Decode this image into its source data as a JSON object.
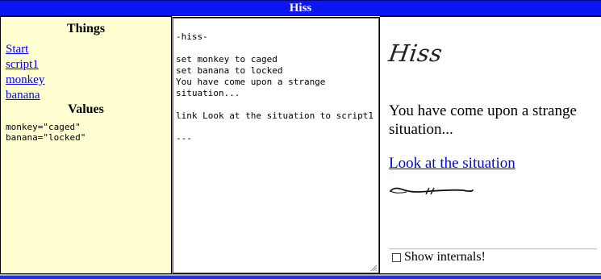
{
  "window": {
    "title": "Hiss"
  },
  "sidebar": {
    "things_heading": "Things",
    "things": [
      "Start",
      "script1",
      "monkey",
      "banana"
    ],
    "values_heading": "Values",
    "values": [
      "monkey=\"caged\"",
      "banana=\"locked\""
    ]
  },
  "editor": {
    "content": "-hiss-\n\nset monkey to caged\nset banana to locked\nYou have come upon a strange situation...\n\nlink Look at the situation to script1\n\n---"
  },
  "story": {
    "title": "Hiss",
    "text": "You have come upon a strange situation...",
    "link": "Look at the situation",
    "show_internals_label": "Show internals!",
    "show_internals_checked": false
  },
  "colors": {
    "title_bar": "#0b16f0",
    "sidebar_bg": "#ffffd2",
    "link": "#0000ee"
  },
  "icons": [
    "resize-grip-icon",
    "flourish-divider-icon",
    "checkbox-icon"
  ]
}
